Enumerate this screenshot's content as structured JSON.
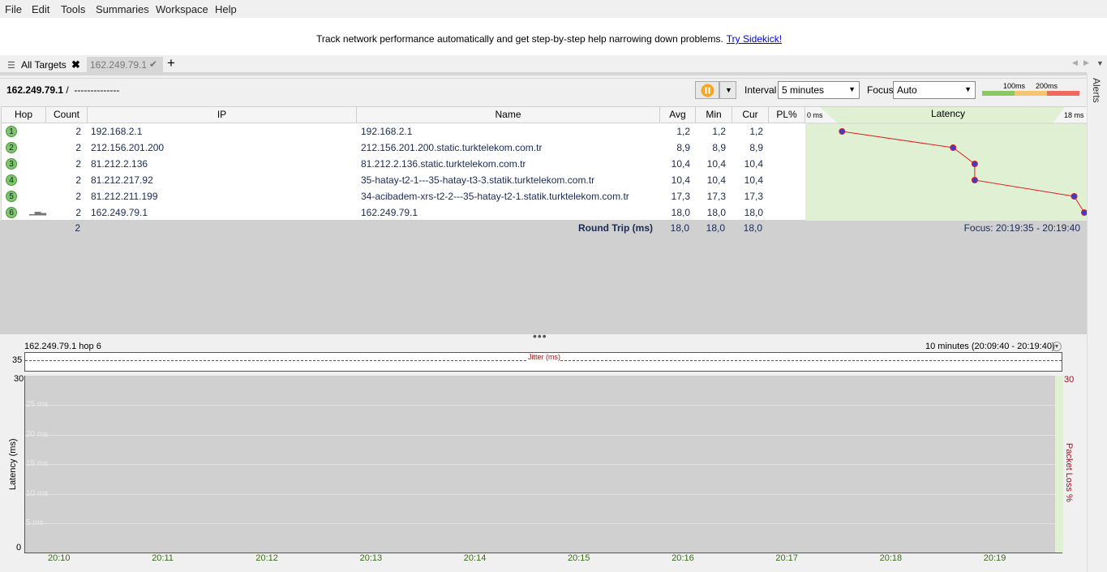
{
  "menu": [
    "File",
    "Edit",
    "Tools",
    "Summaries",
    "Workspace",
    "Help"
  ],
  "banner": {
    "text": "Track network performance automatically and get step-by-step help narrowing down problems.",
    "link": "Try Sidekick!"
  },
  "tabs": {
    "all_targets": "All Targets",
    "target": "162.249.79.1"
  },
  "toolbar": {
    "target": "162.249.79.1",
    "path_sep": " /  --------------",
    "interval_label": "Interval",
    "interval_value": "5 minutes",
    "focus_label": "Focus",
    "focus_value": "Auto",
    "legend_100": "100ms",
    "legend_200": "200ms"
  },
  "alerts_label": "Alerts",
  "table": {
    "headers": [
      "Hop",
      "Count",
      "IP",
      "Name",
      "Avg",
      "Min",
      "Cur",
      "PL%",
      "Latency"
    ],
    "latency_min_label": "0 ms",
    "latency_max_label": "18 ms",
    "rows": [
      {
        "hop": "1",
        "count": "2",
        "ip": "192.168.2.1",
        "name": "192.168.2.1",
        "avg": "1,2",
        "min": "1,2",
        "cur": "1,2",
        "pl": "",
        "lat": 1.2
      },
      {
        "hop": "2",
        "count": "2",
        "ip": "212.156.201.200",
        "name": "212.156.201.200.static.turktelekom.com.tr",
        "avg": "8,9",
        "min": "8,9",
        "cur": "8,9",
        "pl": "",
        "lat": 8.9
      },
      {
        "hop": "3",
        "count": "2",
        "ip": "81.212.2.136",
        "name": "81.212.2.136.static.turktelekom.com.tr",
        "avg": "10,4",
        "min": "10,4",
        "cur": "10,4",
        "pl": "",
        "lat": 10.4
      },
      {
        "hop": "4",
        "count": "2",
        "ip": "81.212.217.92",
        "name": "35-hatay-t2-1---35-hatay-t3-3.statik.turktelekom.com.tr",
        "avg": "10,4",
        "min": "10,4",
        "cur": "10,4",
        "pl": "",
        "lat": 10.4
      },
      {
        "hop": "5",
        "count": "2",
        "ip": "81.212.211.199",
        "name": "34-acibadem-xrs-t2-2---35-hatay-t2-1.statik.turktelekom.com.tr",
        "avg": "17,3",
        "min": "17,3",
        "cur": "17,3",
        "pl": "",
        "lat": 17.3
      },
      {
        "hop": "6",
        "count": "2",
        "ip": "162.249.79.1",
        "name": "162.249.79.1",
        "avg": "18,0",
        "min": "18,0",
        "cur": "18,0",
        "pl": "",
        "lat": 18.0
      }
    ],
    "summary": {
      "count": "2",
      "label": "Round Trip (ms)",
      "avg": "18,0",
      "min": "18,0",
      "cur": "18,0",
      "focus": "Focus: 20:19:35 - 20:19:40"
    }
  },
  "graph": {
    "title": "162.249.79.1 hop 6",
    "range": "10 minutes (20:09:40 - 20:19:40)",
    "jitter_label": "Jitter (ms)",
    "jitter_max": "35",
    "y_max": "30",
    "y_min": "0",
    "pl_max": "30",
    "ylabel": "Latency (ms)",
    "pl_label": "Packet Loss %",
    "gridlines": [
      "25 ms",
      "20 ms",
      "15 ms",
      "10 ms",
      "5 ms"
    ],
    "xticks": [
      "20:10",
      "20:11",
      "20:12",
      "20:13",
      "20:14",
      "20:15",
      "20:16",
      "20:17",
      "20:18",
      "20:19"
    ]
  },
  "colors": {
    "accent_orange": "#f5a623",
    "latency_line": "#e02020",
    "hop_green": "#7ec56b",
    "latency_bg": "#dff0d3",
    "link_blue": "#0000ee"
  }
}
